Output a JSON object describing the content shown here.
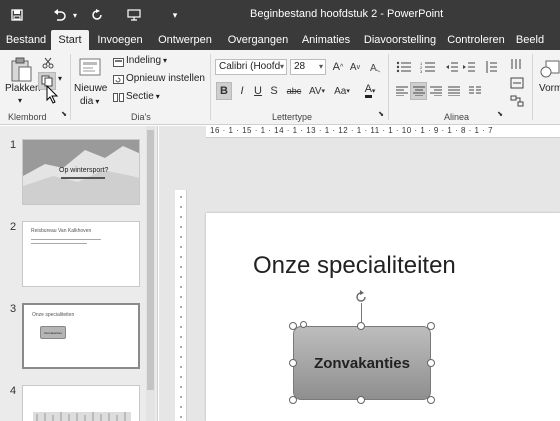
{
  "window": {
    "title": "Beginbestand hoofdstuk 2 - PowerPoint"
  },
  "quick_access": {
    "save_icon": "save-icon",
    "undo_icon": "undo-icon",
    "redo_icon": "redo-icon",
    "present_icon": "present-icon",
    "customize_icon": "customize-icon"
  },
  "tabs": [
    {
      "label": "Bestand",
      "active": false
    },
    {
      "label": "Start",
      "active": true
    },
    {
      "label": "Invoegen",
      "active": false
    },
    {
      "label": "Ontwerpen",
      "active": false
    },
    {
      "label": "Overgangen",
      "active": false
    },
    {
      "label": "Animaties",
      "active": false
    },
    {
      "label": "Diavoorstelling",
      "active": false
    },
    {
      "label": "Controleren",
      "active": false
    },
    {
      "label": "Beeld",
      "active": false
    }
  ],
  "ribbon": {
    "clipboard": {
      "paste_label": "Plakken",
      "group_label": "Klembord",
      "cut_icon": "scissors-icon",
      "copy_icon": "copy-icon",
      "format_painter_icon": "format-painter-icon"
    },
    "slides": {
      "new_slide_label": "Nieuwe",
      "new_slide_label2": "dia",
      "layout_label": "Indeling",
      "reset_label": "Opnieuw instellen",
      "section_label": "Sectie",
      "group_label": "Dia's"
    },
    "font": {
      "font_name": "Calibri (Hoofd",
      "font_size": "28",
      "bold": "B",
      "italic": "I",
      "underline": "U",
      "shadow": "S",
      "strike": "abc",
      "spacing": "AV",
      "case": "Aa",
      "color": "A",
      "grow": "A",
      "shrink": "A",
      "group_label": "Lettertype"
    },
    "paragraph": {
      "group_label": "Alinea"
    },
    "drawing": {
      "label": "Vorm"
    }
  },
  "thumbnails": [
    {
      "number": "1",
      "title": "Op wintersport?",
      "selected": false
    },
    {
      "number": "2",
      "title": "Reisbureau Van Kalkhoven",
      "selected": false
    },
    {
      "number": "3",
      "title": "Onze specialiteiten",
      "shape": "Zonvakanties",
      "selected": true
    },
    {
      "number": "4",
      "title": "",
      "selected": false
    }
  ],
  "ruler": {
    "horizontal": "16 · 1 · 15 · 1 · 14 · 1 · 13 · 1 · 12 · 1 · 11 · 1 · 10 · 1 · 9 · 1 · 8 · 1 · 7"
  },
  "slide": {
    "title": "Onze specialiteiten",
    "shape_text": "Zonvakanties"
  }
}
